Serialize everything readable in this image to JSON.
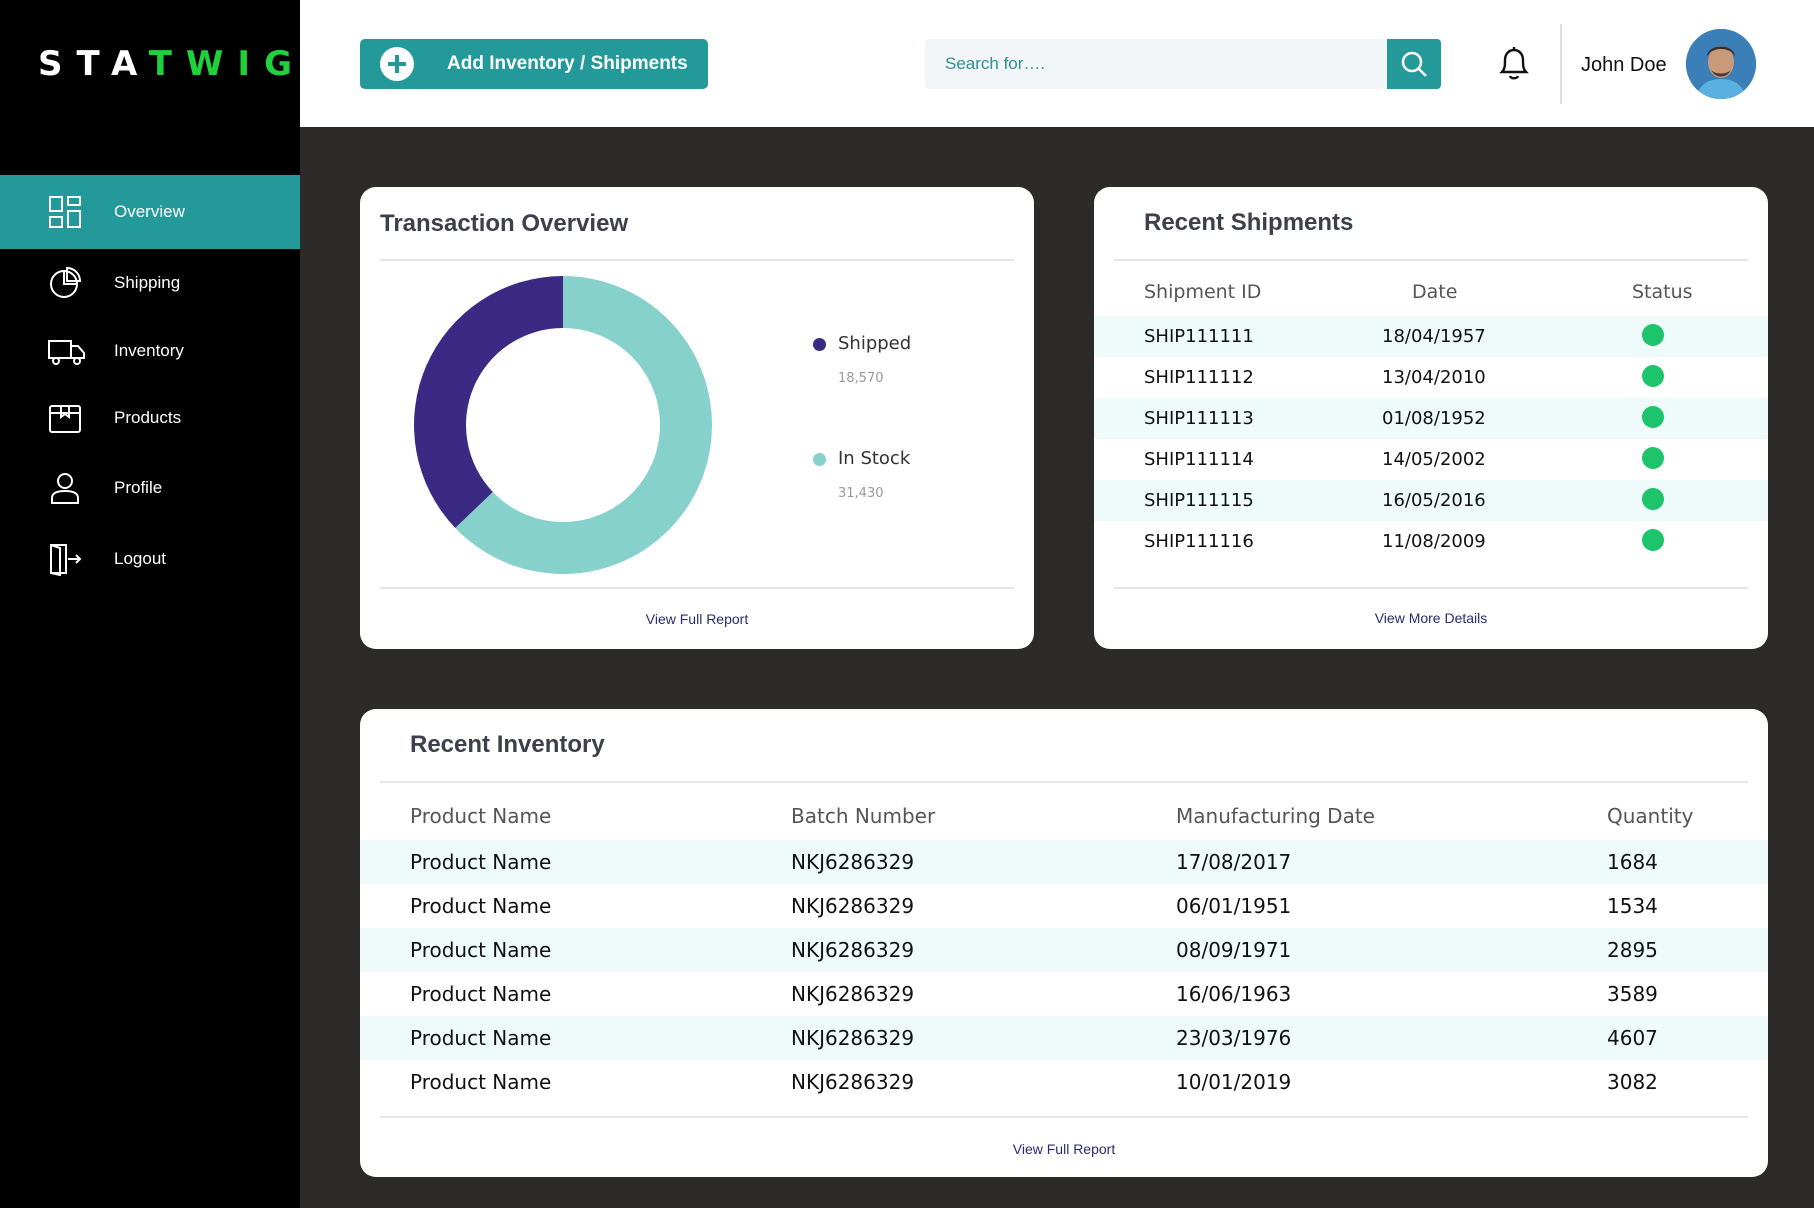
{
  "logo": {
    "part1": "STA",
    "part2": "TWIG"
  },
  "sidebar": {
    "items": [
      {
        "label": "Overview",
        "icon": "grid-icon",
        "active": true
      },
      {
        "label": "Shipping",
        "icon": "pie-chart-icon"
      },
      {
        "label": "Inventory",
        "icon": "truck-icon"
      },
      {
        "label": "Products",
        "icon": "box-icon"
      },
      {
        "label": "Profile",
        "icon": "user-icon"
      },
      {
        "label": "Logout",
        "icon": "logout-icon"
      }
    ]
  },
  "header": {
    "add_button_label": "Add Inventory / Shipments",
    "search_placeholder": "Search for….",
    "username": "John Doe"
  },
  "transaction_overview": {
    "title": "Transaction Overview",
    "legend": [
      {
        "label": "Shipped",
        "value": "18,570",
        "color": "#3a2a84"
      },
      {
        "label": "In Stock",
        "value": "31,430",
        "color": "#86d1cb"
      }
    ],
    "link": "View Full Report"
  },
  "chart_data": {
    "type": "pie",
    "categories": [
      "Shipped",
      "In Stock"
    ],
    "values": [
      18570,
      31430
    ],
    "colors": [
      "#3a2a84",
      "#86d1cb"
    ],
    "donut": true,
    "title": "Transaction Overview"
  },
  "recent_shipments": {
    "title": "Recent Shipments",
    "columns": [
      "Shipment ID",
      "Date",
      "Status"
    ],
    "rows": [
      {
        "id": "SHIP111111",
        "date": "18/04/1957",
        "status_color": "#1ec46b"
      },
      {
        "id": "SHIP111112",
        "date": "13/04/2010",
        "status_color": "#1ec46b"
      },
      {
        "id": "SHIP111113",
        "date": "01/08/1952",
        "status_color": "#1ec46b"
      },
      {
        "id": "SHIP111114",
        "date": "14/05/2002",
        "status_color": "#1ec46b"
      },
      {
        "id": "SHIP111115",
        "date": "16/05/2016",
        "status_color": "#1ec46b"
      },
      {
        "id": "SHIP111116",
        "date": "11/08/2009",
        "status_color": "#1ec46b"
      }
    ],
    "link": "View More Details"
  },
  "recent_inventory": {
    "title": "Recent Inventory",
    "columns": [
      "Product Name",
      "Batch Number",
      "Manufacturing Date",
      "Quantity"
    ],
    "rows": [
      {
        "name": "Product Name",
        "batch": "NKJ6286329",
        "date": "17/08/2017",
        "qty": "1684"
      },
      {
        "name": "Product Name",
        "batch": "NKJ6286329",
        "date": "06/01/1951",
        "qty": "1534"
      },
      {
        "name": "Product Name",
        "batch": "NKJ6286329",
        "date": "08/09/1971",
        "qty": "2895"
      },
      {
        "name": "Product Name",
        "batch": "NKJ6286329",
        "date": "16/06/1963",
        "qty": "3589"
      },
      {
        "name": "Product Name",
        "batch": "NKJ6286329",
        "date": "23/03/1976",
        "qty": "4607"
      },
      {
        "name": "Product Name",
        "batch": "NKJ6286329",
        "date": "10/01/2019",
        "qty": "3082"
      }
    ],
    "link": "View Full Report"
  }
}
